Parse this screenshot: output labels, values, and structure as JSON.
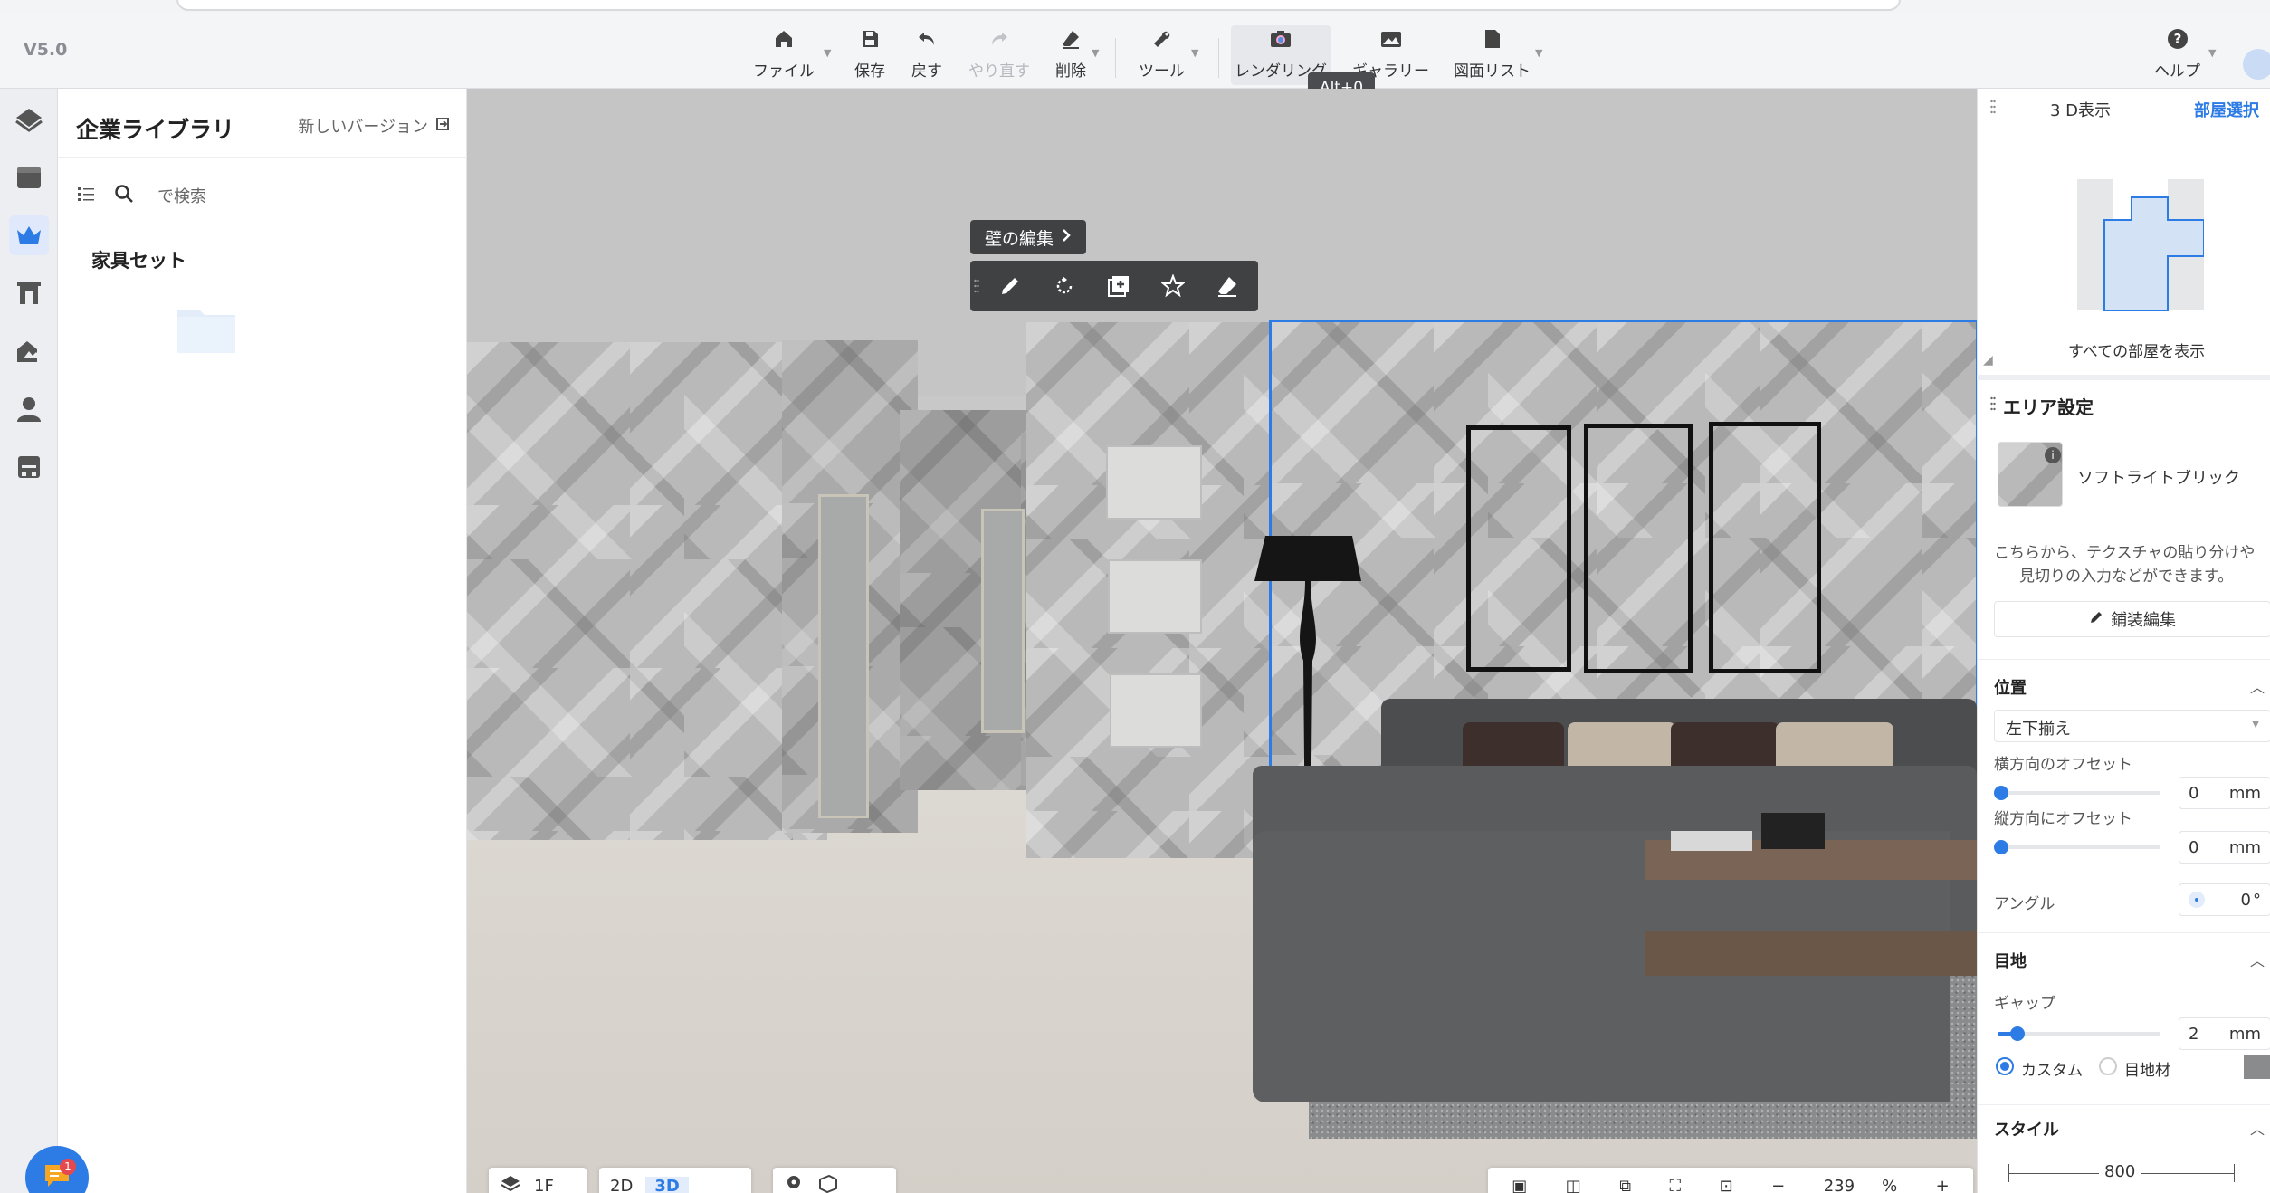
{
  "app": {
    "version": "V5.0"
  },
  "toolbar": {
    "file": "ファイル",
    "save": "保存",
    "undo": "戻す",
    "redo": "やり直す",
    "delete": "削除",
    "tools": "ツール",
    "render": "レンダリング",
    "gallery": "ギャラリー",
    "drawings": "図面リスト",
    "help": "ヘルプ",
    "render_tooltip": "Alt+0"
  },
  "library": {
    "title": "企業ライブラリ",
    "new_version": "新しいバージョン",
    "search_placeholder": "で検索",
    "section": "家具セット"
  },
  "wall_edit": {
    "label": "壁の編集"
  },
  "bottom": {
    "floor": "1F",
    "view2d": "2D",
    "view3d": "3D",
    "zoom": "239",
    "zoom_unit": "%"
  },
  "view3d_panel": {
    "title": "3 D表示",
    "room_select": "部屋選択",
    "show_all": "すべての部屋を表示"
  },
  "area": {
    "title": "エリア設定",
    "material": "ソフトライトブリック",
    "description_line1": "こちらから、テクスチャの貼り分けや",
    "description_line2": "見切りの入力などができます。",
    "edit_button": "鋪装編集",
    "position_heading": "位置",
    "align_value": "左下揃え",
    "h_offset_label": "横方向のオフセット",
    "h_offset_value": "0",
    "v_offset_label": "縦方向にオフセット",
    "v_offset_value": "0",
    "unit_mm": "mm",
    "angle_label": "アングル",
    "angle_value": "0",
    "angle_unit": "°",
    "joint_heading": "目地",
    "gap_label": "ギャップ",
    "gap_value": "2",
    "gap_slider_fraction": 0.12,
    "radio_custom": "カスタム",
    "radio_joint": "目地材",
    "style_heading": "スタイル",
    "style_width": "800"
  },
  "colors": {
    "accent": "#2d7be5",
    "badge": "#e5484d"
  },
  "chat": {
    "badge": "1"
  }
}
